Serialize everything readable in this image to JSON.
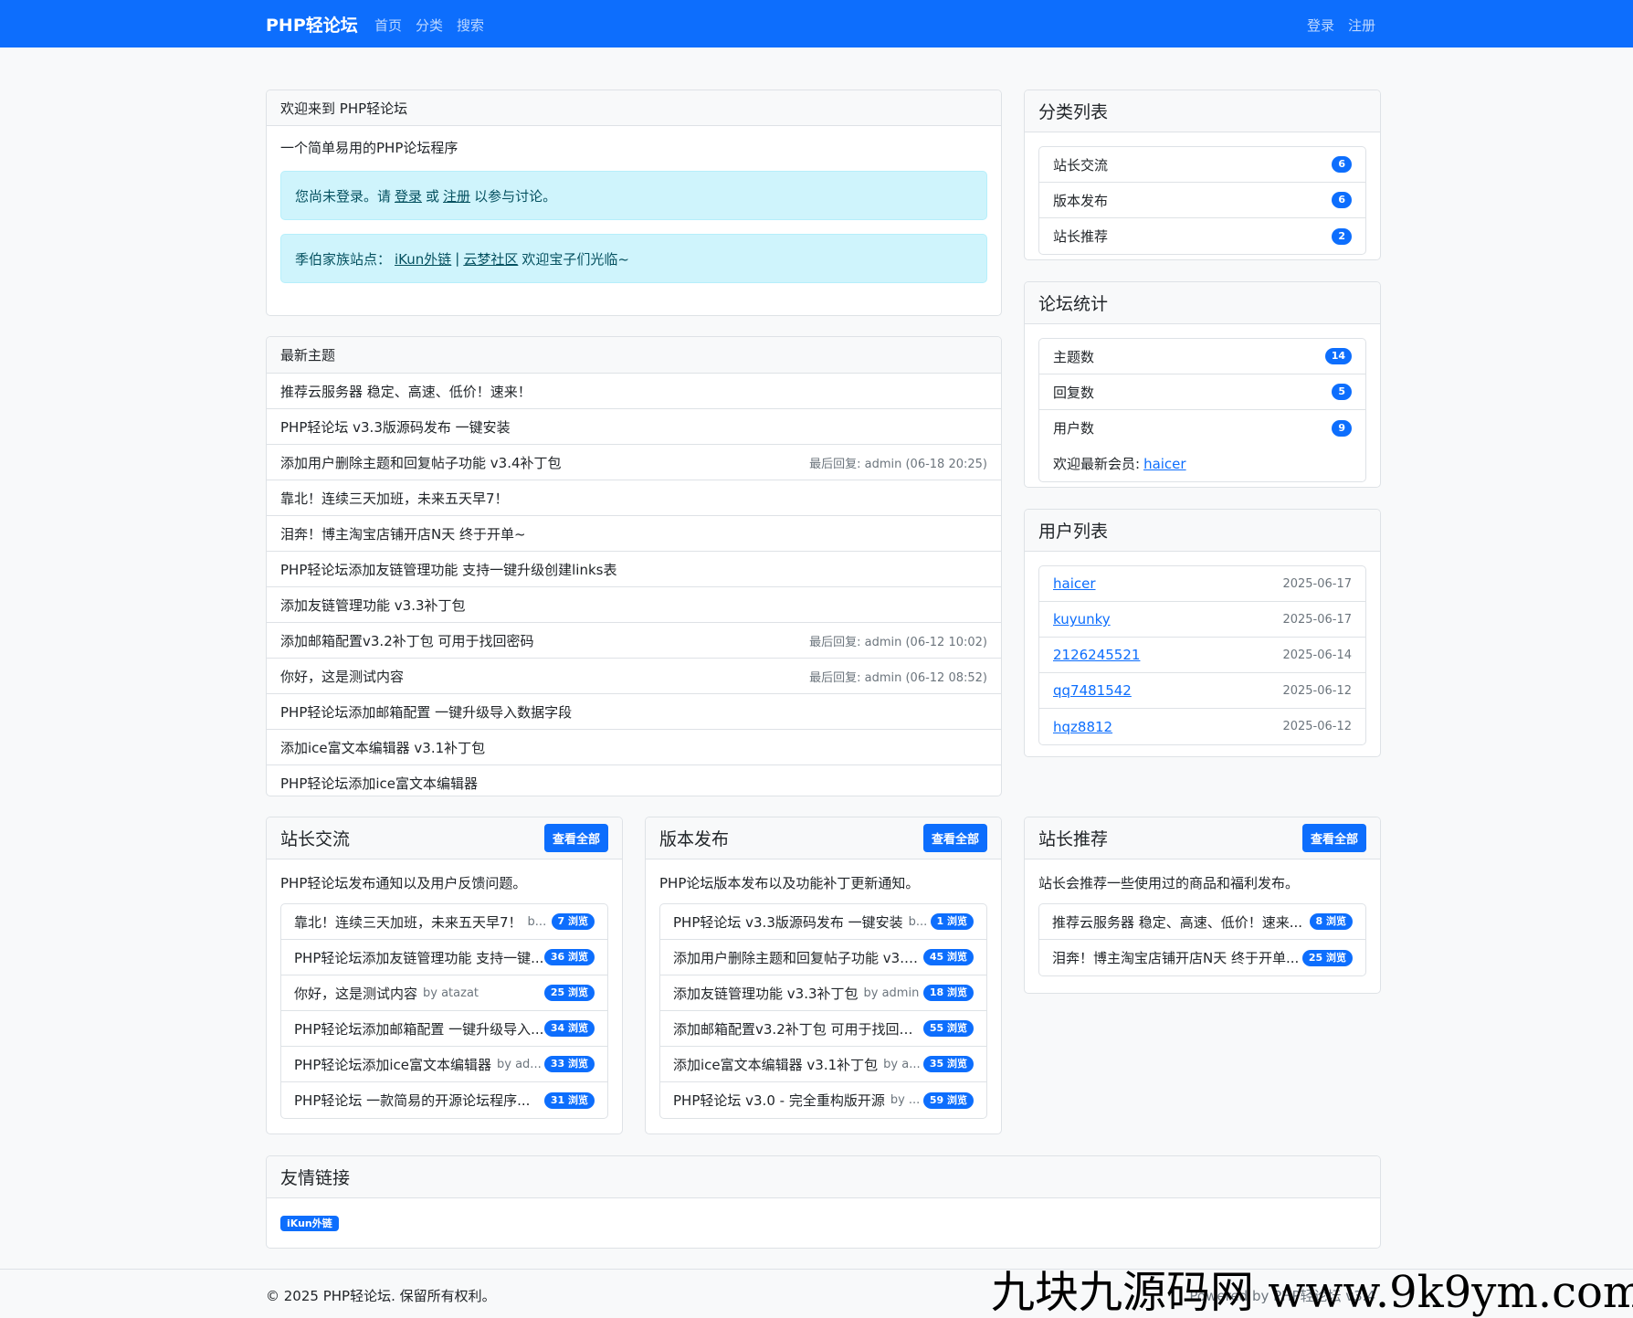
{
  "nav": {
    "brand": "PHP轻论坛",
    "links": [
      "首页",
      "分类",
      "搜索"
    ],
    "right": [
      "登录",
      "注册"
    ]
  },
  "welcome": {
    "header": "欢迎来到 PHP轻论坛",
    "desc": "一个简单易用的PHP论坛程序",
    "alert1": {
      "pre": "您尚未登录。请",
      "login": "登录",
      "mid": "或",
      "register": "注册",
      "post": "以参与讨论。"
    },
    "alert2": {
      "pre": "季伯家族站点：",
      "link1": "iKun外链",
      "sep": "|",
      "link2": "云梦社区",
      "post": "欢迎宝子们光临~"
    }
  },
  "latest": {
    "header": "最新主题",
    "items": [
      {
        "title": "推荐云服务器 稳定、高速、低价！速来！",
        "meta": ""
      },
      {
        "title": "PHP轻论坛 v3.3版源码发布 一键安装",
        "meta": ""
      },
      {
        "title": "添加用户删除主题和回复帖子功能 v3.4补丁包",
        "meta": "最后回复: admin (06-18 20:25)"
      },
      {
        "title": "靠北！连续三天加班，未来五天早7！",
        "meta": ""
      },
      {
        "title": "泪奔！博主淘宝店铺开店N天 终于开单~",
        "meta": ""
      },
      {
        "title": "PHP轻论坛添加友链管理功能 支持一键升级创建links表",
        "meta": ""
      },
      {
        "title": "添加友链管理功能 v3.3补丁包",
        "meta": ""
      },
      {
        "title": "添加邮箱配置v3.2补丁包 可用于找回密码",
        "meta": "最后回复: admin (06-12 10:02)"
      },
      {
        "title": "你好，这是测试内容",
        "meta": "最后回复: admin (06-12 08:52)"
      },
      {
        "title": "PHP轻论坛添加邮箱配置 一键升级导入数据字段",
        "meta": ""
      },
      {
        "title": "添加ice富文本编辑器 v3.1补丁包",
        "meta": ""
      },
      {
        "title": "PHP轻论坛添加ice富文本编辑器",
        "meta": ""
      }
    ]
  },
  "categories": {
    "header": "分类列表",
    "items": [
      {
        "name": "站长交流",
        "count": "6"
      },
      {
        "name": "版本发布",
        "count": "6"
      },
      {
        "name": "站长推荐",
        "count": "2"
      }
    ]
  },
  "stats": {
    "header": "论坛统计",
    "items": [
      {
        "name": "主题数",
        "count": "14"
      },
      {
        "name": "回复数",
        "count": "5"
      },
      {
        "name": "用户数",
        "count": "9"
      }
    ],
    "newest_label": "欢迎最新会员:",
    "newest_user": "haicer"
  },
  "users": {
    "header": "用户列表",
    "items": [
      {
        "name": "haicer",
        "date": "2025-06-17"
      },
      {
        "name": "kuyunky",
        "date": "2025-06-17"
      },
      {
        "name": "2126245521",
        "date": "2025-06-14"
      },
      {
        "name": "qq7481542",
        "date": "2025-06-12"
      },
      {
        "name": "hqz8812",
        "date": "2025-06-12"
      }
    ]
  },
  "sections": [
    {
      "title": "站长交流",
      "button": "查看全部",
      "desc": "PHP轻论坛发布通知以及用户反馈问题。",
      "items": [
        {
          "title": "靠北！连续三天加班，未来五天早7！",
          "by": "b...",
          "views": "7 浏览"
        },
        {
          "title": "PHP轻论坛添加友链管理功能 支持一键...",
          "by": "",
          "views": "36 浏览"
        },
        {
          "title": "你好，这是测试内容",
          "by": "by atazat",
          "views": "25 浏览"
        },
        {
          "title": "PHP轻论坛添加邮箱配置 一键升级导入...",
          "by": "",
          "views": "34 浏览"
        },
        {
          "title": "PHP轻论坛添加ice富文本编辑器",
          "by": "by ad...",
          "views": "33 浏览"
        },
        {
          "title": "PHP轻论坛 一款简易的开源论坛程序...",
          "by": "",
          "views": "31 浏览"
        }
      ]
    },
    {
      "title": "版本发布",
      "button": "查看全部",
      "desc": "PHP论坛版本发布以及功能补丁更新通知。",
      "items": [
        {
          "title": "PHP轻论坛 v3.3版源码发布 一键安装",
          "by": "b...",
          "views": "1 浏览"
        },
        {
          "title": "添加用户删除主题和回复帖子功能 v3.4...",
          "by": "",
          "views": "45 浏览"
        },
        {
          "title": "添加友链管理功能 v3.3补丁包",
          "by": "by admin",
          "views": "18 浏览"
        },
        {
          "title": "添加邮箱配置v3.2补丁包 可用于找回密...",
          "by": "",
          "views": "55 浏览"
        },
        {
          "title": "添加ice富文本编辑器 v3.1补丁包",
          "by": "by a...",
          "views": "35 浏览"
        },
        {
          "title": "PHP轻论坛 v3.0 - 完全重构版开源",
          "by": "by ...",
          "views": "59 浏览"
        }
      ]
    },
    {
      "title": "站长推荐",
      "button": "查看全部",
      "desc": "站长会推荐一些使用过的商品和福利发布。",
      "items": [
        {
          "title": "推荐云服务器 稳定、高速、低价！速来...",
          "by": "",
          "views": "8 浏览"
        },
        {
          "title": "泪奔！博主淘宝店铺开店N天 终于开单...",
          "by": "",
          "views": "25 浏览"
        }
      ]
    }
  ],
  "links": {
    "header": "友情链接",
    "items": [
      "iKun外链"
    ]
  },
  "footer": {
    "copyright": "© 2025 PHP轻论坛. 保留所有权利。",
    "powered": "Powered by PHP轻论坛 v3.4"
  },
  "watermark": "九块九源码网 www.9k9ym.com",
  "colors": {
    "primary": "#0d6efd",
    "alert_bg": "#cff4fc",
    "page_bg": "#f8f9fa"
  }
}
